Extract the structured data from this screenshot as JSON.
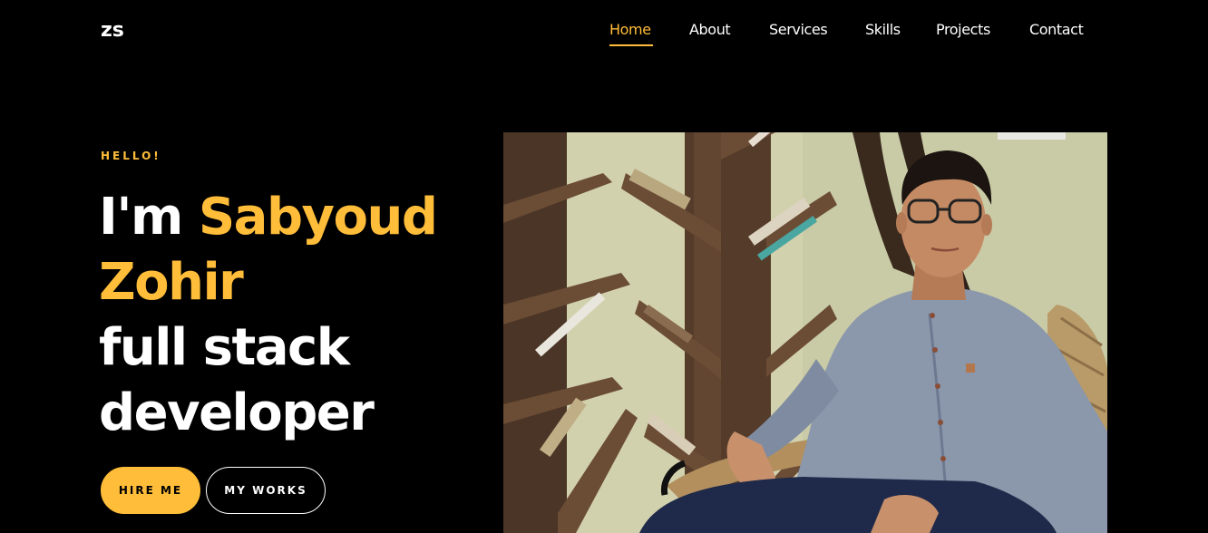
{
  "brand": {
    "logo": "zs",
    "accent_color": "#ffbd39"
  },
  "nav": {
    "items": [
      {
        "label": "Home",
        "active": true
      },
      {
        "label": "About",
        "active": false
      },
      {
        "label": "Services",
        "active": false
      },
      {
        "label": "Skills",
        "active": false
      },
      {
        "label": "Projects",
        "active": false
      },
      {
        "label": "Contact",
        "active": false
      }
    ]
  },
  "hero": {
    "greeting": "HELLO!",
    "intro": "I'm",
    "name_first": "Sabyoud",
    "name_last": "Zohir",
    "role_line1": "full stack",
    "role_line2": "developer",
    "primary_button": "HIRE ME",
    "secondary_button": "MY WORKS"
  },
  "photo": {
    "subject": "portrait of a man seated in front of a bookshelf"
  }
}
